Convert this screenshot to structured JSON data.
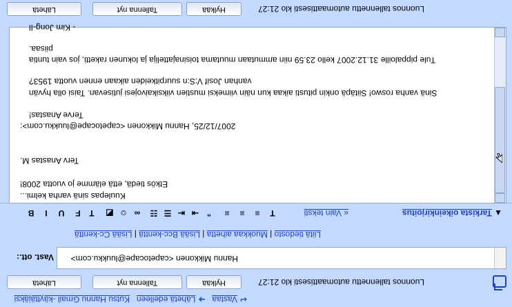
{
  "toolbar": {
    "send": "Lähetä",
    "save": "Tallenna nyt",
    "discard": "Hylkää",
    "status": "Luonnos tallennettu automaattisesti klo 21:27"
  },
  "format_bar": {
    "plain_text": "« Vain teksti",
    "spellcheck": "Tarkista oikeinkirjoitus"
  },
  "recipients": {
    "to_label": "Vast. ott.:",
    "to_value": "Hannu Mikkonen <capetocape@luukku.com>",
    "links": [
      "Lisää Cc-kenttä",
      "Lisää Bcc-kenttä",
      "Muokkaa aihetta",
      "Liitä tiedosto"
    ]
  },
  "bottom_links": {
    "reply": "Vastaa",
    "forward": "Lähetä edelleen",
    "invite": "Kutsu Hannu Gmail -käyttäjäksi"
  },
  "body_lines": [
    "Kuulepas sinä vanha kelmi...",
    "Etkös tiedä, että elämme jo vuotta 2008!",
    "Terv Anastas M.",
    "2007/12/25, Hannu Mikkonen <capetocape@luukku.com>:",
    "Terve Anastas!",
    "Sinä vanha roswo! Siitäpä onkin pitusti aikaa kun näin viimeksi mustien viiksikaivojesi jutisevan. Taisi olla hyvän",
    "vanhan Josif V:S:n suurpitkeiden aikaan ennen vuotta 1953?",
    "Tule pippaloille 31.12.2007 kello 23.59 niin ammutaan muutama toisinajattelija ja lokunen raketti, jos vain tuntia",
    "piisaa.",
    "- Kim Jong-Il"
  ]
}
